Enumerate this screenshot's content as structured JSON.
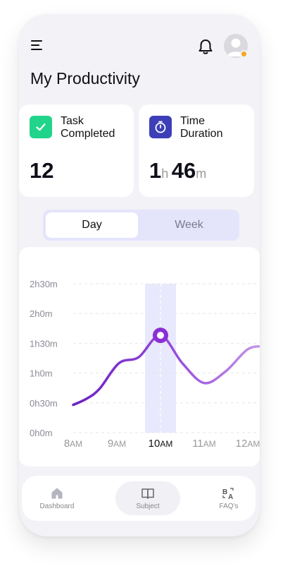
{
  "header": {
    "title": "My Productivity",
    "menu_icon": "hamburger-menu-icon",
    "notification_icon": "bell-icon",
    "avatar_icon": "user-avatar-icon",
    "avatar_badge_color": "#f5a623"
  },
  "stats": {
    "task": {
      "label_line1": "Task",
      "label_line2": "Completed",
      "value": "12",
      "icon": "check-icon",
      "color": "#22d48a"
    },
    "time": {
      "label_line1": "Time",
      "label_line2": "Duration",
      "hours": "1",
      "hours_unit": "h",
      "minutes": "46",
      "minutes_unit": "m",
      "icon": "stopwatch-icon",
      "color": "#3d3fb8"
    }
  },
  "toggle": {
    "day_label": "Day",
    "week_label": "Week",
    "selected": "Day"
  },
  "chart_data": {
    "type": "line",
    "y_ticks": [
      "0h0m",
      "0h30m",
      "1h0m",
      "1h30m",
      "2h0m",
      "2h30m"
    ],
    "x_ticks": [
      {
        "hour": "8",
        "suffix": "AM"
      },
      {
        "hour": "9",
        "suffix": "AM"
      },
      {
        "hour": "10",
        "suffix": "AM"
      },
      {
        "hour": "11",
        "suffix": "AM"
      },
      {
        "hour": "12",
        "suffix": "AM"
      }
    ],
    "ylim_minutes": [
      0,
      150
    ],
    "x": [
      8.0,
      8.3,
      8.6,
      9.05,
      9.5,
      10.0,
      10.5,
      11.0,
      11.5,
      12.0,
      12.4
    ],
    "y_minutes": [
      28,
      34,
      44,
      70,
      76,
      98,
      70,
      50,
      62,
      84,
      87
    ],
    "highlight": {
      "x": 10.0,
      "y_minutes": 98
    },
    "grid": true,
    "line_color_start": "#6a1fc2",
    "line_color_end": "#c99be8",
    "highlight_band_color": "#e8e9fc"
  },
  "nav": {
    "items": [
      {
        "label": "Dashboard",
        "icon": "home-icon",
        "active": false
      },
      {
        "label": "Subject",
        "icon": "book-icon",
        "active": true
      },
      {
        "label": "FAQ's",
        "icon": "translate-icon",
        "active": false
      }
    ]
  }
}
